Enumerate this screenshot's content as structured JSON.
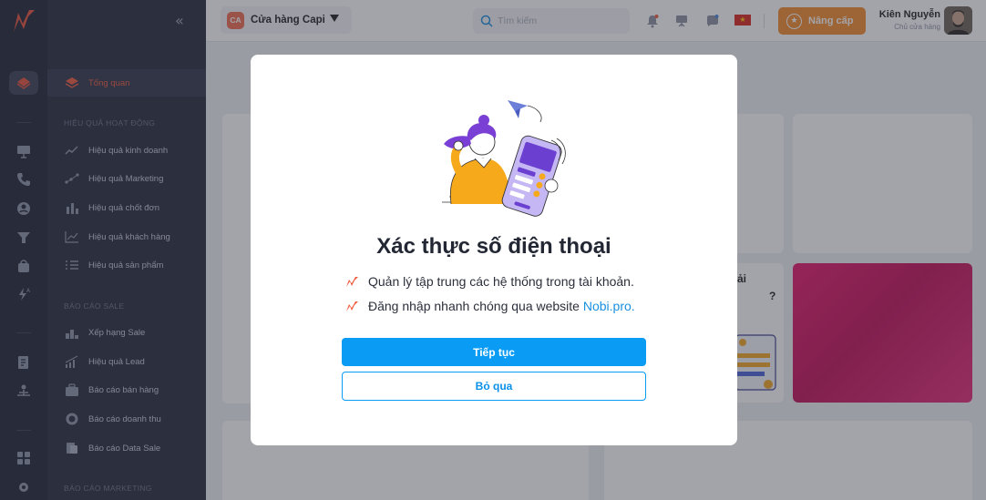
{
  "sidebar": {
    "collapse_icon": "double-chevron-left-icon",
    "active_item": "Tổng quan",
    "section_performance": "HIỆU QUẢ HOẠT ĐỘNG",
    "performance_items": [
      "Hiệu quả kinh doanh",
      "Hiệu quả Marketing",
      "Hiệu quả chốt đơn",
      "Hiệu quả khách hàng",
      "Hiệu quả sản phẩm"
    ],
    "section_sale": "BÁO CÁO SALE",
    "sale_items": [
      "Xếp hạng Sale",
      "Hiệu quả Lead",
      "Báo cáo bán hàng",
      "Báo cáo doanh thu",
      "Báo cáo Data Sale"
    ],
    "section_marketing": "BÁO CÁO MARKETING"
  },
  "topbar": {
    "store_badge": "CA",
    "store_name": "Cửa hàng Capi",
    "search_placeholder": "Tìm kiếm",
    "upgrade_label": "Nâng cấp",
    "user_name": "Kiên Nguyễn",
    "user_role": "Chủ cửa hàng",
    "flag": "VN"
  },
  "background": {
    "partial_text_1": "ải",
    "partial_text_2": "?"
  },
  "modal": {
    "title": "Xác thực số điện thoại",
    "bullet_1": "Quản lý tập trung các hệ thống trong tài khoản.",
    "bullet_2_prefix": "Đăng nhập nhanh chóng qua website ",
    "bullet_2_link": "Nobi.pro.",
    "continue_label": "Tiếp tục",
    "skip_label": "Bỏ qua"
  },
  "colors": {
    "brand_orange": "#f05a3c",
    "primary_blue": "#0a9cf5",
    "upgrade_orange": "#f58a2a",
    "sidebar_dark": "#262b3b"
  }
}
